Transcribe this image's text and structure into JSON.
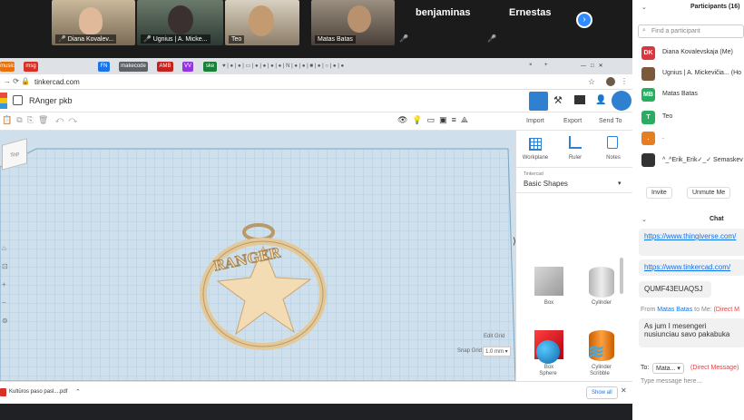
{
  "video": {
    "tiles": [
      {
        "name": "Diana Kovalev..."
      },
      {
        "name": "Ugnius | A. Micke..."
      },
      {
        "name": "Teo"
      },
      {
        "name": "Matas Batas"
      }
    ],
    "name_tiles": [
      "benjaminas",
      "Ernestas"
    ],
    "next": "›"
  },
  "browser": {
    "tabs": [
      "music",
      "msg",
      "FN",
      "makecode",
      "AMB",
      "VV",
      "ske"
    ],
    "url": "tinkercad.com",
    "active_tab_close": "×"
  },
  "tinkercad": {
    "title": "RAnger pkb",
    "actions": [
      "Import",
      "Export",
      "Send To"
    ],
    "tools": [
      "Workplane",
      "Ruler",
      "Notes"
    ],
    "library_small": "Tinkercad",
    "library": "Basic Shapes",
    "shapes": [
      "Box",
      "Cylinder",
      "Box",
      "Cylinder",
      "Sphere",
      "Scribble"
    ],
    "model_text": "RANGER",
    "edit_grid": "Edit Grid",
    "snap_grid_label": "Snap Grid",
    "snap_grid_value": "1.0 mm ▾",
    "view_cube": "Top"
  },
  "download": {
    "file": "Kultūros paso pasl....pdf",
    "show_all": "Show all"
  },
  "zoom": {
    "participants_title": "Participants (16)",
    "search_placeholder": "Find a participant",
    "participants": [
      {
        "initials": "DK",
        "name": "Diana Kovalevskaja (Me)",
        "color": "#d9363e"
      },
      {
        "initials": "",
        "name": "Ugnius | A. Mickevičia... (Ho",
        "color": "#7a5a3a"
      },
      {
        "initials": "MB",
        "name": "Matas Batas",
        "color": "#27ae60"
      },
      {
        "initials": "T",
        "name": "Teo",
        "color": "#27ae60"
      },
      {
        "initials": ".",
        "name": ".",
        "color": "#e67e22"
      },
      {
        "initials": "",
        "name": "^_^Erik_Erik✓_✓ Semaskev",
        "color": "#333333"
      }
    ],
    "invite": "Invite",
    "unmute": "Unmute Me",
    "chat_title": "Chat",
    "messages": [
      {
        "text": "https://www.thingiverse.com/",
        "link": true
      },
      {
        "text": "https://www.tinkercad.com/",
        "link": true
      },
      {
        "text": "QUMF43EUAQSJ",
        "link": false
      }
    ],
    "from_line": {
      "prefix": "From",
      "sender": "Matas Batas",
      "to": "to Me:",
      "tag": "(Direct M"
    },
    "last_message": "As jum I mesengeri nusiunciau savo pakabuka",
    "to_label": "To:",
    "to_value": "Mata... ▾",
    "direct_message": "(Direct Message)",
    "type_placeholder": "Type message here..."
  }
}
